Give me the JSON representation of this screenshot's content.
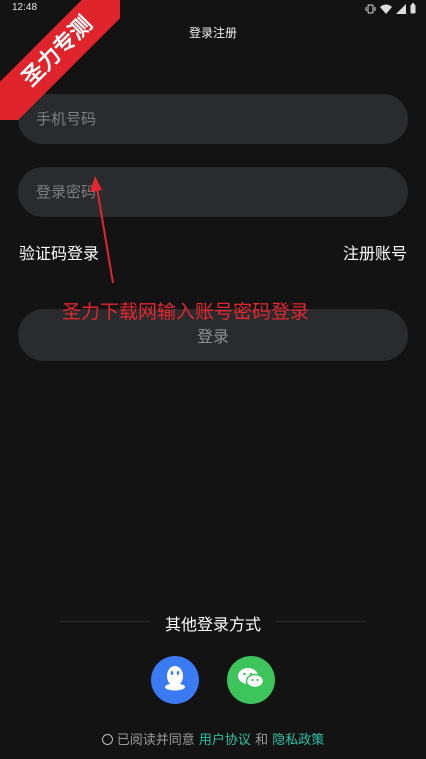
{
  "status": {
    "time": "12:48"
  },
  "header": {
    "title": "登录注册"
  },
  "form": {
    "phone_placeholder": "手机号码",
    "password_placeholder": "登录密码",
    "sms_login": "验证码登录",
    "register": "注册账号",
    "login": "登录"
  },
  "other_login": {
    "title": "其他登录方式",
    "qq_color": "#3a7bf3",
    "wechat_color": "#3dc55c"
  },
  "agreement": {
    "prefix": "已阅读并同意",
    "user_agreement": "用户协议",
    "and": "和",
    "privacy_policy": "隐私政策",
    "accent_color": "#27c2a6"
  },
  "overlay": {
    "ribbon": "圣力专测",
    "annotation": "圣力下载网输入账号密码登录",
    "color": "#e3262f"
  }
}
